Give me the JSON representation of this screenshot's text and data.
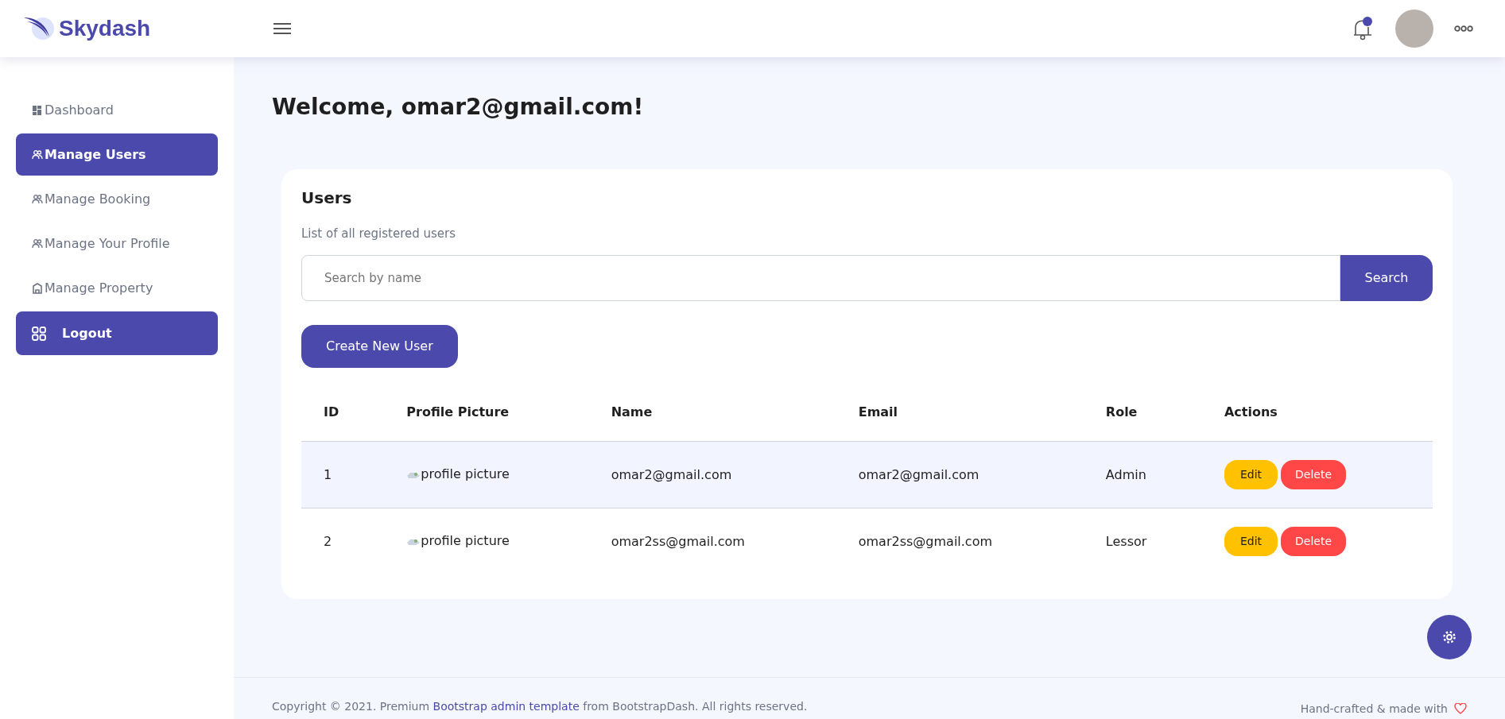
{
  "brand": "Skydash",
  "sidebar": {
    "items": [
      {
        "label": "Dashboard",
        "kind": "grid",
        "selected": false
      },
      {
        "label": "Manage Users",
        "kind": "users",
        "selected": true
      },
      {
        "label": "Manage Booking",
        "kind": "users",
        "selected": false
      },
      {
        "label": "Manage Your Profile",
        "kind": "users",
        "selected": false
      },
      {
        "label": "Manage Property",
        "kind": "house",
        "selected": false
      }
    ],
    "logout": "Logout"
  },
  "welcome": "Welcome, omar2@gmail.com!",
  "card": {
    "title": "Users",
    "description": "List of all registered users",
    "search": {
      "placeholder": "Search by name",
      "button": "Search"
    },
    "create_button": "Create New User",
    "table": {
      "columns": [
        "ID",
        "Profile Picture",
        "Name",
        "Email",
        "Role",
        "Actions"
      ],
      "rows": [
        {
          "id": "1",
          "picture": "profile picture",
          "name": "omar2@gmail.com",
          "email": "omar2@gmail.com",
          "role": "Admin",
          "edit": "Edit",
          "delete": "Delete",
          "selected": true
        },
        {
          "id": "2",
          "picture": "profile picture",
          "name": "omar2ss@gmail.com",
          "email": "omar2ss@gmail.com",
          "role": "Lessor",
          "edit": "Edit",
          "delete": "Delete",
          "selected": false
        }
      ]
    }
  },
  "footer": {
    "copyright_before": "Copyright © 2021. Premium ",
    "link": "Bootstrap admin template",
    "copyright_after": " from BootstrapDash. All rights reserved.",
    "made_with": "Hand-crafted & made with"
  }
}
